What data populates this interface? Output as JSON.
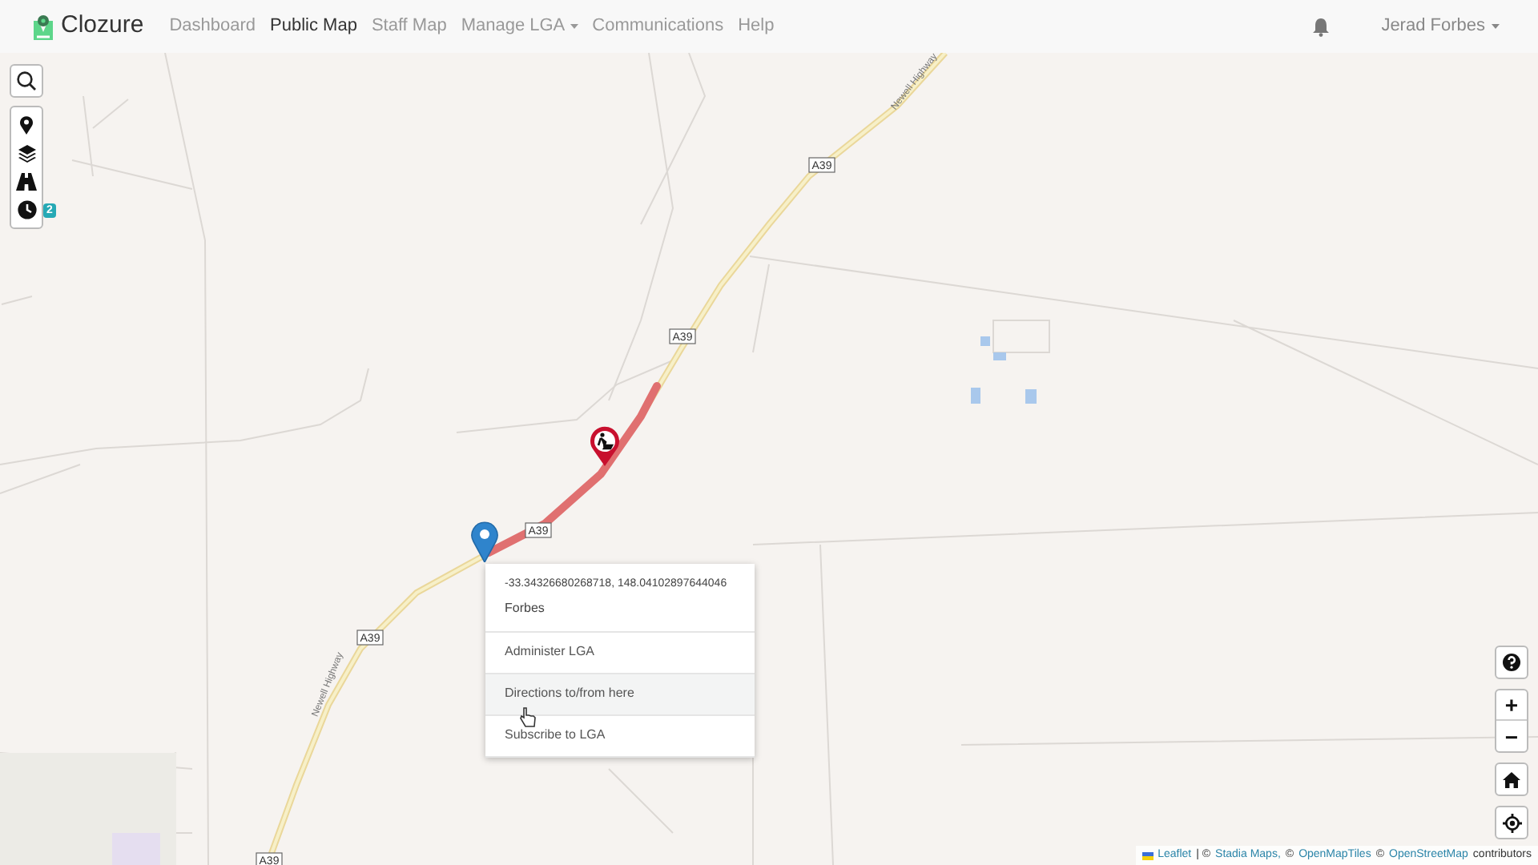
{
  "brand": "Clozure",
  "nav": [
    {
      "label": "Dashboard",
      "selected": false,
      "dropdown": false
    },
    {
      "label": "Public Map",
      "selected": true,
      "dropdown": false
    },
    {
      "label": "Staff Map",
      "selected": false,
      "dropdown": false
    },
    {
      "label": "Manage LGA",
      "selected": false,
      "dropdown": true
    },
    {
      "label": "Communications",
      "selected": false,
      "dropdown": false
    },
    {
      "label": "Help",
      "selected": false,
      "dropdown": false
    }
  ],
  "user": {
    "name": "Jerad Forbes",
    "dropdown": true
  },
  "map": {
    "road_labels": [
      "A39",
      "A39",
      "A39",
      "A39",
      "A39"
    ],
    "highway_labels": [
      "Newell Highway",
      "Newell Highway"
    ]
  },
  "history_badge": "2",
  "popup": {
    "coordinates": "-33.34326680268718, 148.04102897644046",
    "place": "Forbes",
    "items": [
      {
        "label": "Administer LGA",
        "hovered": false
      },
      {
        "label": "Directions to/from here",
        "hovered": true
      },
      {
        "label": "Subscribe to LGA",
        "hovered": false
      }
    ]
  },
  "zoom": {
    "in": "+",
    "out": "−"
  },
  "attribution": [
    {
      "kind": "link",
      "text": "Leaflet"
    },
    {
      "kind": "text",
      "text": "| ©"
    },
    {
      "kind": "link",
      "text": "Stadia Maps,"
    },
    {
      "kind": "text",
      "text": "©"
    },
    {
      "kind": "link",
      "text": "OpenMapTiles"
    },
    {
      "kind": "text",
      "text": "©"
    },
    {
      "kind": "link",
      "text": "OpenStreetMap"
    },
    {
      "kind": "text",
      "text": "contributors"
    }
  ]
}
